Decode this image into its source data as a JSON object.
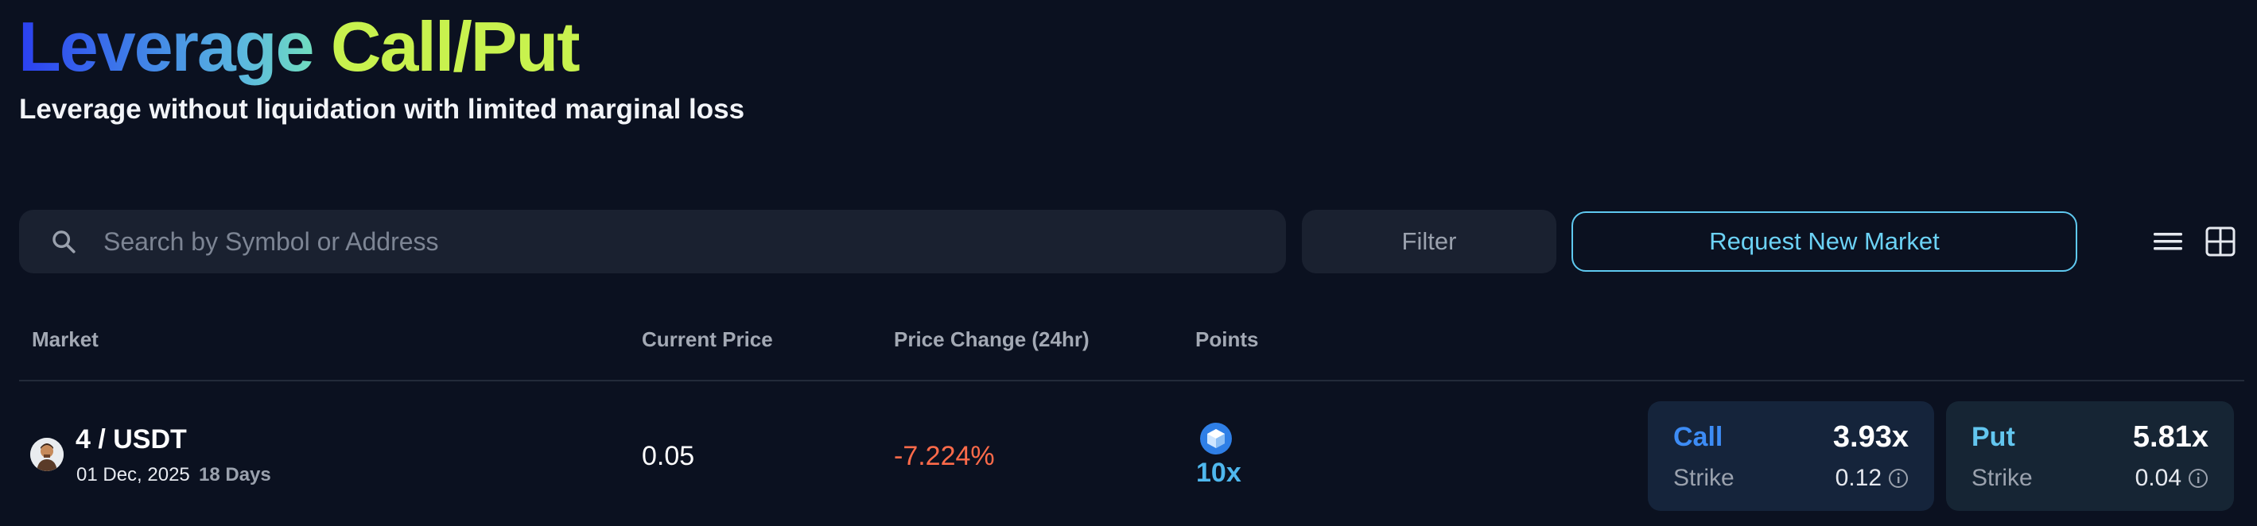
{
  "header": {
    "title_part1": "Leverage",
    "title_part2": "Call/Put",
    "subtitle": "Leverage without liquidation with limited marginal loss"
  },
  "toolbar": {
    "search_placeholder": "Search by Symbol or Address",
    "search_value": "",
    "filter_label": "Filter",
    "request_label": "Request New Market"
  },
  "table": {
    "columns": [
      "Market",
      "Current Price",
      "Price Change (24hr)",
      "Points"
    ],
    "rows": [
      {
        "pair": "4 / USDT",
        "date": "01 Dec, 2025",
        "days": "18 Days",
        "price": "0.05",
        "change": "-7.224%",
        "points": "10x",
        "call": {
          "label": "Call",
          "leverage": "3.93x",
          "strike_label": "Strike",
          "strike": "0.12"
        },
        "put": {
          "label": "Put",
          "leverage": "5.81x",
          "strike_label": "Strike",
          "strike": "0.04"
        }
      }
    ]
  },
  "colors": {
    "background": "#0b1120",
    "accent_blue": "#3d8cf5",
    "accent_cyan": "#63c6ef",
    "negative": "#ff6b4a",
    "title_green": "#c8f24e"
  },
  "icons": [
    "search-icon",
    "list-view-icon",
    "grid-view-icon",
    "avatar",
    "points-cube-icon",
    "info-icon"
  ]
}
